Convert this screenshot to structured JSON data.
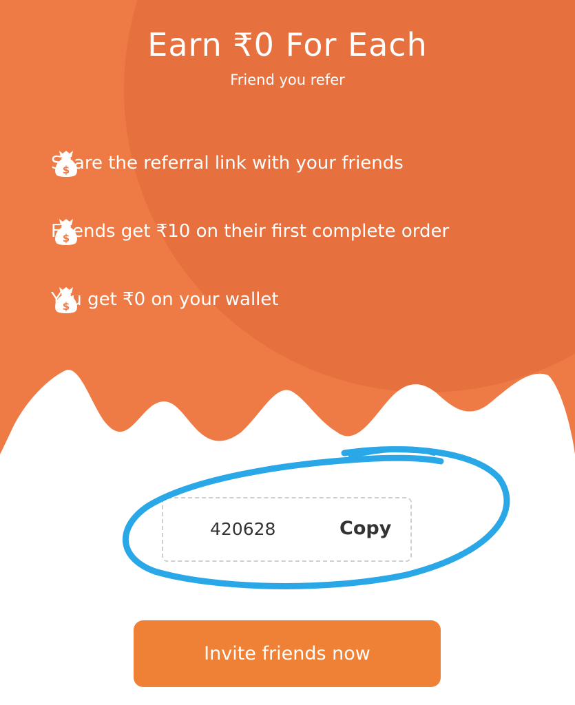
{
  "hero": {
    "title": "Earn ₹0 For Each",
    "subtitle": "Friend you refer"
  },
  "benefits": [
    {
      "icon": "money-bag-icon",
      "text": "Share the referral link with your friends"
    },
    {
      "icon": "money-bag-icon",
      "text": "Friends get ₹10 on their first complete order"
    },
    {
      "icon": "money-bag-icon",
      "text": "You get ₹0 on your wallet"
    }
  ],
  "referral": {
    "code": "420628",
    "copy_label": "Copy"
  },
  "invite": {
    "label": "Invite friends now"
  },
  "colors": {
    "hero_orange": "#ee7b45",
    "hero_circle": "#e2683a",
    "button_orange": "#ee8136",
    "scribble_blue": "#29a7e6"
  }
}
